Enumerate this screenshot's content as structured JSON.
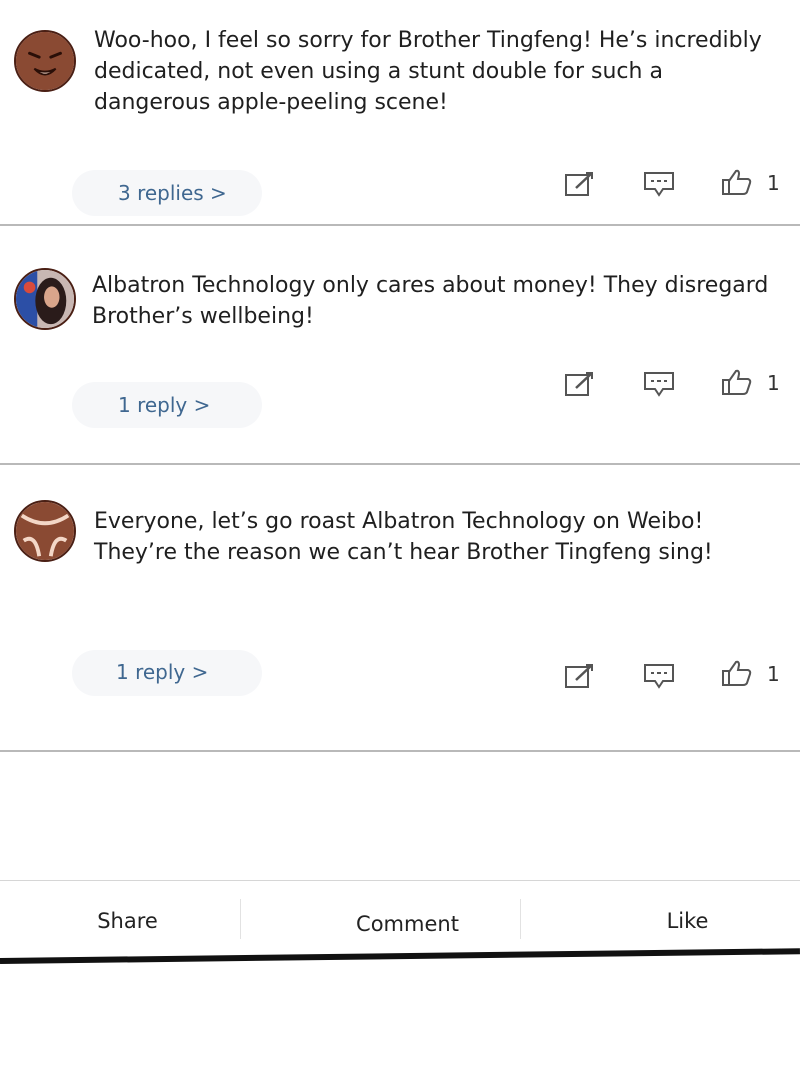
{
  "comments": [
    {
      "text": "Woo-hoo, I feel so sorry for Brother Tingfeng! He’s incredibly dedicated, not even using a stunt double for such a dangerous apple-peeling scene!",
      "replies_label": "3 replies >",
      "likes": "1",
      "avatar_icon": "crying-face-avatar"
    },
    {
      "text": "Albatron Technology only cares about money! They disregard Brother’s wellbeing!",
      "replies_label": "1 reply >",
      "likes": "1",
      "avatar_icon": "user-photo-avatar"
    },
    {
      "text": "Everyone, let’s go roast Albatron Technology on Weibo! They’re the reason we can’t hear Brother Tingfeng sing!",
      "replies_label": "1 reply >",
      "likes": "1",
      "avatar_icon": "angry-face-avatar"
    }
  ],
  "action_icons": [
    "edit-icon",
    "comment-icon",
    "thumbs-up-icon"
  ],
  "toolbar": {
    "share_label": "Share",
    "comment_label": "Comment",
    "like_label": "Like"
  },
  "colors": {
    "link": "#3f6790",
    "avatar_brown": "#8a4a33",
    "divider": "#b9b9b9",
    "icon": "#555555"
  }
}
